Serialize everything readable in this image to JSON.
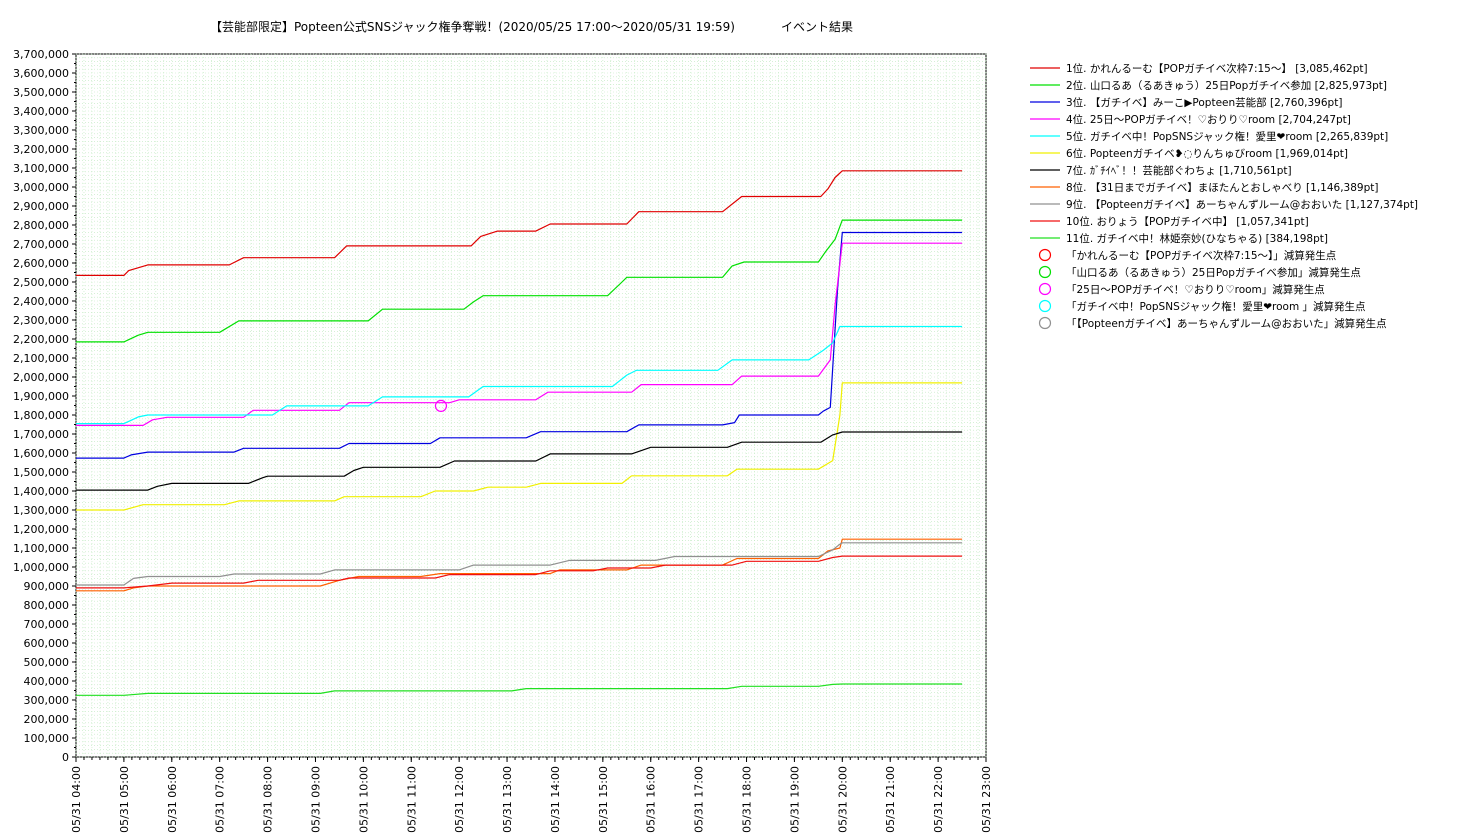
{
  "chart_data": {
    "type": "line",
    "title": "【芸能部限定】Popteen公式SNSジャック権争奪戦！(2020/05/25 17:00～2020/05/31 19:59)",
    "subtitle": "イベント結果",
    "xlabel": "",
    "ylabel": "",
    "ylim": [
      0,
      3700000
    ],
    "y_tick_step": 100000,
    "y_tick_labels": [
      "0",
      "100,000",
      "200,000",
      "300,000",
      "400,000",
      "500,000",
      "600,000",
      "700,000",
      "800,000",
      "900,000",
      "1,000,000",
      "1,100,000",
      "1,200,000",
      "1,300,000",
      "1,400,000",
      "1,500,000",
      "1,600,000",
      "1,700,000",
      "1,800,000",
      "1,900,000",
      "2,000,000",
      "2,100,000",
      "2,200,000",
      "2,300,000",
      "2,400,000",
      "2,500,000",
      "2,600,000",
      "2,700,000",
      "2,800,000",
      "2,900,000",
      "3,000,000",
      "3,100,000",
      "3,200,000",
      "3,300,000",
      "3,400,000",
      "3,500,000",
      "3,600,000",
      "3,700,000"
    ],
    "x_tick_labels": [
      "05/31 04:00",
      "05/31 05:00",
      "05/31 06:00",
      "05/31 07:00",
      "05/31 08:00",
      "05/31 09:00",
      "05/31 10:00",
      "05/31 11:00",
      "05/31 12:00",
      "05/31 13:00",
      "05/31 14:00",
      "05/31 15:00",
      "05/31 16:00",
      "05/31 17:00",
      "05/31 18:00",
      "05/31 19:00",
      "05/31 20:00",
      "05/31 21:00",
      "05/31 22:00",
      "05/31 23:00"
    ],
    "xlim_hours": [
      4,
      23
    ],
    "grid": true,
    "legend_position": "right",
    "series": [
      {
        "name": "1位. かれんるーむ【POPガチイベ次枠7:15～】 [3,085,462pt]",
        "color": "#e00000",
        "points": [
          [
            4,
            2535000
          ],
          [
            5,
            2535000
          ],
          [
            5.1,
            2560000
          ],
          [
            5.5,
            2590000
          ],
          [
            7.2,
            2590000
          ],
          [
            7.5,
            2628000
          ],
          [
            9.4,
            2628000
          ],
          [
            9.65,
            2690000
          ],
          [
            11.25,
            2690000
          ],
          [
            12.25,
            2690000
          ],
          [
            12.45,
            2740000
          ],
          [
            12.8,
            2768000
          ],
          [
            13.6,
            2768000
          ],
          [
            13.9,
            2805000
          ],
          [
            15.5,
            2805000
          ],
          [
            15.75,
            2870000
          ],
          [
            17.5,
            2870000
          ],
          [
            17.9,
            2950000
          ],
          [
            19.55,
            2950000
          ],
          [
            19.7,
            2990000
          ],
          [
            19.85,
            3050000
          ],
          [
            20,
            3085462
          ],
          [
            22.5,
            3085462
          ]
        ]
      },
      {
        "name": "2位. 山口るあ（るあきゅう）25日Popガチイベ参加 [2,825,973pt]",
        "color": "#00e000",
        "points": [
          [
            4,
            2185000
          ],
          [
            5,
            2185000
          ],
          [
            5.3,
            2220000
          ],
          [
            5.5,
            2235000
          ],
          [
            7,
            2235000
          ],
          [
            7.4,
            2295000
          ],
          [
            9.6,
            2295000
          ],
          [
            10.1,
            2295000
          ],
          [
            10.4,
            2357000
          ],
          [
            12.1,
            2357000
          ],
          [
            12.3,
            2395000
          ],
          [
            12.5,
            2428000
          ],
          [
            15.1,
            2428000
          ],
          [
            15.4,
            2500000
          ],
          [
            15.5,
            2525000
          ],
          [
            17.5,
            2525000
          ],
          [
            17.7,
            2585000
          ],
          [
            17.95,
            2605000
          ],
          [
            19.5,
            2605000
          ],
          [
            19.65,
            2660000
          ],
          [
            19.85,
            2725000
          ],
          [
            20,
            2825973
          ],
          [
            22.5,
            2825973
          ]
        ]
      },
      {
        "name": "3位. 【ガチイベ】みーこ▶Popteen芸能部 [2,760,396pt]",
        "color": "#0000e0",
        "points": [
          [
            4,
            1573000
          ],
          [
            5,
            1573000
          ],
          [
            5.15,
            1590000
          ],
          [
            5.5,
            1605000
          ],
          [
            7.3,
            1605000
          ],
          [
            7.5,
            1625000
          ],
          [
            9.5,
            1625000
          ],
          [
            9.7,
            1650000
          ],
          [
            11.4,
            1650000
          ],
          [
            11.6,
            1680000
          ],
          [
            13.4,
            1680000
          ],
          [
            13.7,
            1712000
          ],
          [
            15.5,
            1712000
          ],
          [
            15.75,
            1748000
          ],
          [
            17.5,
            1748000
          ],
          [
            17.75,
            1760000
          ],
          [
            17.85,
            1800000
          ],
          [
            19.5,
            1800000
          ],
          [
            19.6,
            1820000
          ],
          [
            19.75,
            1840000
          ],
          [
            19.9,
            2460000
          ],
          [
            20,
            2760396
          ],
          [
            22.5,
            2760396
          ]
        ]
      },
      {
        "name": "4位. 25日～POPガチイベ！♡おりり♡room [2,704,247pt]",
        "color": "#ff00ff",
        "points": [
          [
            4,
            1745000
          ],
          [
            5.4,
            1745000
          ],
          [
            5.6,
            1775000
          ],
          [
            5.9,
            1788000
          ],
          [
            7.5,
            1788000
          ],
          [
            7.7,
            1825000
          ],
          [
            9.5,
            1825000
          ],
          [
            9.7,
            1865000
          ],
          [
            11.8,
            1865000
          ],
          [
            12,
            1880000
          ],
          [
            13.6,
            1880000
          ],
          [
            13.85,
            1920000
          ],
          [
            15.6,
            1920000
          ],
          [
            15.8,
            1960000
          ],
          [
            17.7,
            1960000
          ],
          [
            17.9,
            2005000
          ],
          [
            19.5,
            2005000
          ],
          [
            19.75,
            2090000
          ],
          [
            19.85,
            2380000
          ],
          [
            20,
            2704247
          ],
          [
            22.5,
            2704247
          ]
        ]
      },
      {
        "name": "5位. ガチイベ中！PopSNSジャック権！愛里❤room [2,265,839pt]",
        "color": "#00ffff",
        "points": [
          [
            4,
            1755000
          ],
          [
            5,
            1755000
          ],
          [
            5.3,
            1790000
          ],
          [
            5.5,
            1800000
          ],
          [
            7.6,
            1800000
          ],
          [
            8.1,
            1800000
          ],
          [
            8.4,
            1848000
          ],
          [
            9.6,
            1848000
          ],
          [
            10.1,
            1848000
          ],
          [
            10.4,
            1895000
          ],
          [
            12.2,
            1895000
          ],
          [
            12.5,
            1950000
          ],
          [
            15.2,
            1950000
          ],
          [
            15.5,
            2010000
          ],
          [
            15.7,
            2035000
          ],
          [
            17.4,
            2035000
          ],
          [
            17.7,
            2090000
          ],
          [
            19.3,
            2090000
          ],
          [
            19.6,
            2140000
          ],
          [
            19.8,
            2180000
          ],
          [
            19.95,
            2265839
          ],
          [
            22.5,
            2265839
          ]
        ]
      },
      {
        "name": "6位. Popteenガチイベ❥◌りんちゅびroom [1,969,014pt]",
        "color": "#f0f000",
        "points": [
          [
            4,
            1300000
          ],
          [
            5,
            1300000
          ],
          [
            5.4,
            1328000
          ],
          [
            7.1,
            1328000
          ],
          [
            7.4,
            1348000
          ],
          [
            9.4,
            1348000
          ],
          [
            9.6,
            1370000
          ],
          [
            11.2,
            1370000
          ],
          [
            11.5,
            1400000
          ],
          [
            12.3,
            1400000
          ],
          [
            12.6,
            1420000
          ],
          [
            13.4,
            1420000
          ],
          [
            13.7,
            1440000
          ],
          [
            15.4,
            1440000
          ],
          [
            15.6,
            1480000
          ],
          [
            17.6,
            1480000
          ],
          [
            17.8,
            1515000
          ],
          [
            19.5,
            1515000
          ],
          [
            19.8,
            1560000
          ],
          [
            19.95,
            1800000
          ],
          [
            20,
            1969014
          ],
          [
            22.5,
            1969014
          ]
        ]
      },
      {
        "name": "7位. ｶﾞﾁｲﾍﾞ！！芸能部ぐわちょ [1,710,561pt]",
        "color": "#000000",
        "points": [
          [
            4,
            1405000
          ],
          [
            5.5,
            1405000
          ],
          [
            5.7,
            1425000
          ],
          [
            6,
            1440000
          ],
          [
            7.6,
            1440000
          ],
          [
            7.9,
            1470000
          ],
          [
            8,
            1478000
          ],
          [
            9.6,
            1478000
          ],
          [
            9.8,
            1508000
          ],
          [
            10,
            1525000
          ],
          [
            11.6,
            1525000
          ],
          [
            11.9,
            1558000
          ],
          [
            13.6,
            1558000
          ],
          [
            13.9,
            1595000
          ],
          [
            15.6,
            1595000
          ],
          [
            16,
            1630000
          ],
          [
            17.6,
            1630000
          ],
          [
            17.9,
            1657000
          ],
          [
            19.55,
            1657000
          ],
          [
            19.8,
            1695000
          ],
          [
            20,
            1710561
          ],
          [
            22.5,
            1710561
          ]
        ]
      },
      {
        "name": "8位. 【31日までガチイベ】まほたんとおしゃべり [1,146,389pt]",
        "color": "#ff6000",
        "points": [
          [
            4,
            875000
          ],
          [
            5,
            875000
          ],
          [
            5.2,
            890000
          ],
          [
            5.5,
            900000
          ],
          [
            9.1,
            900000
          ],
          [
            9.5,
            930000
          ],
          [
            9.9,
            950000
          ],
          [
            11.2,
            950000
          ],
          [
            11.6,
            965000
          ],
          [
            13.9,
            965000
          ],
          [
            14.1,
            985000
          ],
          [
            15.5,
            985000
          ],
          [
            15.8,
            1010000
          ],
          [
            17.5,
            1010000
          ],
          [
            17.8,
            1045000
          ],
          [
            19.5,
            1045000
          ],
          [
            19.7,
            1085000
          ],
          [
            19.95,
            1100000
          ],
          [
            20,
            1146389
          ],
          [
            22.5,
            1146389
          ]
        ]
      },
      {
        "name": "9位. 【Popteenガチイベ】あーちゃんずルーム@おおいた [1,127,374pt]",
        "color": "#909090",
        "points": [
          [
            4,
            905000
          ],
          [
            5,
            905000
          ],
          [
            5.2,
            940000
          ],
          [
            5.5,
            950000
          ],
          [
            7,
            950000
          ],
          [
            7.3,
            963000
          ],
          [
            9.1,
            963000
          ],
          [
            9.4,
            985000
          ],
          [
            12,
            985000
          ],
          [
            12.3,
            1010000
          ],
          [
            13.9,
            1010000
          ],
          [
            14.3,
            1035000
          ],
          [
            16.1,
            1035000
          ],
          [
            16.5,
            1055000
          ],
          [
            18,
            1055000
          ],
          [
            18.2,
            1055000
          ],
          [
            19.5,
            1055000
          ],
          [
            19.8,
            1090000
          ],
          [
            19.95,
            1120000
          ],
          [
            20,
            1127374
          ],
          [
            22.5,
            1127374
          ]
        ]
      },
      {
        "name": "10位. おりょう【POPガチイベ中】 [1,057,341pt]",
        "color": "#f01010",
        "points": [
          [
            4,
            890000
          ],
          [
            5,
            890000
          ],
          [
            5.5,
            900000
          ],
          [
            6,
            915000
          ],
          [
            7.5,
            915000
          ],
          [
            7.8,
            930000
          ],
          [
            9.5,
            930000
          ],
          [
            9.7,
            942000
          ],
          [
            11.5,
            942000
          ],
          [
            11.8,
            960000
          ],
          [
            13.6,
            960000
          ],
          [
            13.9,
            980000
          ],
          [
            14.8,
            980000
          ],
          [
            15.1,
            995000
          ],
          [
            16,
            995000
          ],
          [
            16.3,
            1010000
          ],
          [
            17.7,
            1010000
          ],
          [
            18,
            1030000
          ],
          [
            19.5,
            1030000
          ],
          [
            19.8,
            1050000
          ],
          [
            20,
            1057341
          ],
          [
            22.5,
            1057341
          ]
        ]
      },
      {
        "name": "11位. ガチイベ中！林姫奈妙(ひなちゃる) [384,198pt]",
        "color": "#20e020",
        "points": [
          [
            4,
            325000
          ],
          [
            5,
            325000
          ],
          [
            5.5,
            335000
          ],
          [
            9.1,
            335000
          ],
          [
            9.4,
            348000
          ],
          [
            13.1,
            348000
          ],
          [
            13.4,
            360000
          ],
          [
            17.6,
            360000
          ],
          [
            17.9,
            372000
          ],
          [
            19.5,
            372000
          ],
          [
            19.8,
            382000
          ],
          [
            20,
            384198
          ],
          [
            22.5,
            384198
          ]
        ]
      }
    ],
    "markers": [
      {
        "name": "「かれんるーむ【POPガチイベ次枠7:15～】」減算発生点",
        "color": "#ff0000",
        "points": []
      },
      {
        "name": "「山口るあ（るあきゅう）25日Popガチイベ参加」減算発生点",
        "color": "#00e000",
        "points": []
      },
      {
        "name": "「25日～POPガチイベ！♡おりり♡room」減算発生点",
        "color": "#ff00ff",
        "points": [
          [
            11.62,
            1848000
          ]
        ]
      },
      {
        "name": "「ガチイベ中！PopSNSジャック権！愛里❤room 」減算発生点",
        "color": "#00ffff",
        "points": []
      },
      {
        "name": "「【Popteenガチイベ】あーちゃんずルーム@おおいた」減算発生点",
        "color": "#909090",
        "points": []
      }
    ]
  }
}
